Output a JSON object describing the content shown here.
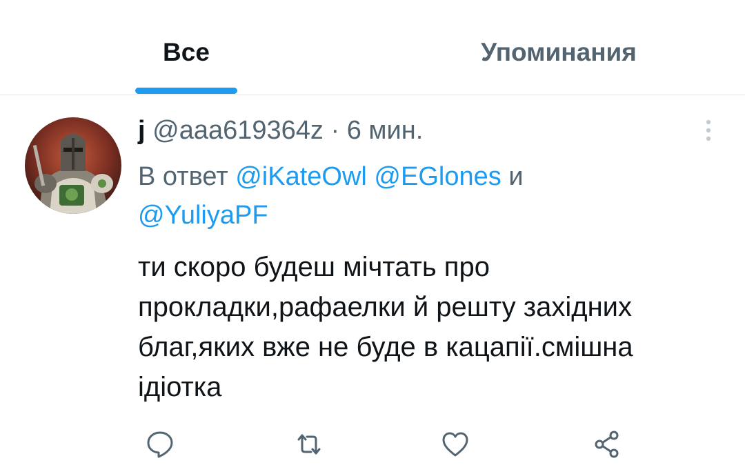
{
  "tabs": [
    {
      "label": "Все",
      "active": true
    },
    {
      "label": "Упоминания",
      "active": false
    }
  ],
  "tweet": {
    "display_name": "j",
    "handle": "@aaa619364z",
    "separator": "·",
    "time": "6 мин.",
    "reply_prefix": "В ответ",
    "mentions": [
      "@iKateOwl",
      "@EGlones",
      "@YuliyaPF"
    ],
    "reply_conjunction": "и",
    "text": "ти скоро будеш мічтать про\nпрокладки,рафаелки й решту західних\nблаг,яких вже не буде в кацапії.смішна\nідіотка"
  },
  "actions": [
    {
      "name": "reply",
      "icon": "reply-icon"
    },
    {
      "name": "retweet",
      "icon": "retweet-icon"
    },
    {
      "name": "like",
      "icon": "like-icon"
    },
    {
      "name": "share",
      "icon": "share-icon"
    }
  ],
  "colors": {
    "accent": "#1d9bf0",
    "text_primary": "#0f1419",
    "text_secondary": "#536471",
    "divider": "#e3e8ec"
  }
}
